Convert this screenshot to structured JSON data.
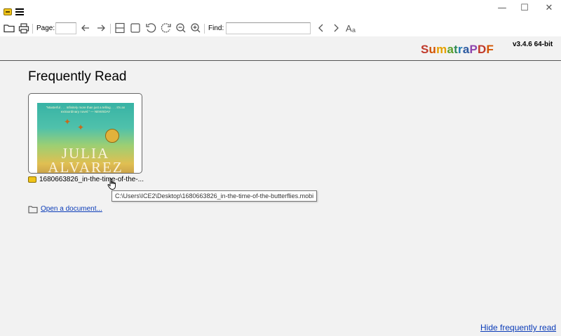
{
  "window": {
    "minimize_glyph": "—",
    "maximize_glyph": "☐",
    "close_glyph": "✕"
  },
  "toolbar": {
    "page_label": "Page:",
    "page_value": "",
    "find_label": "Find:",
    "find_value": "",
    "icons": [
      "open-folder-icon",
      "print-icon",
      "prev-page-icon",
      "next-page-icon",
      "single-page-view-icon",
      "fit-page-icon",
      "rotate-left-icon",
      "rotate-right-icon",
      "zoom-out-icon",
      "zoom-in-icon",
      "find-prev-icon",
      "find-next-icon",
      "match-case-icon"
    ]
  },
  "branding": {
    "logo_parts": [
      "S",
      "u",
      "m",
      "a",
      "t",
      "r",
      "a",
      "P",
      "D",
      "F"
    ],
    "logo_colors": [
      "#c0392b",
      "#d35400",
      "#e6a100",
      "#5aa02c",
      "#2e8b57",
      "#1f78b4",
      "#2c5aa0",
      "#8e44ad",
      "#c0392b",
      "#d35400"
    ],
    "version": "v3.4.6 64-bit"
  },
  "main": {
    "heading": "Frequently Read",
    "recent": [
      {
        "name": "1680663826_in-the-time-of-the-...",
        "cover_quote": "\"Masterful . . . Infinitely more than just a telling . . . It's an extraordinary novel.\" — NEWSDAY",
        "cover_title": "JULIA ALVAREZ"
      }
    ],
    "tooltip": "C:\\Users\\ICE2\\Desktop\\1680663826_in-the-time-of-the-butterflies.mobi",
    "open_document": "Open a document...",
    "hide_frequently_read": "Hide frequently read"
  },
  "colors": {
    "link": "#0b3cb8",
    "background": "#f2f2f2",
    "toolbar_bg": "#ffffff"
  }
}
